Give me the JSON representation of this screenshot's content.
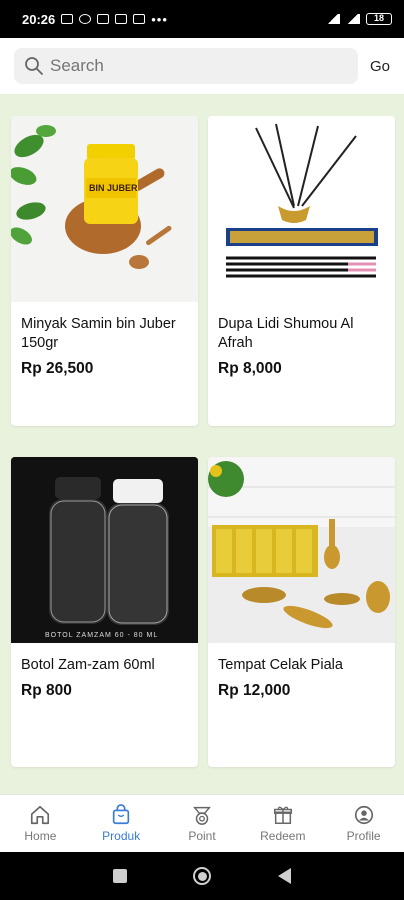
{
  "status": {
    "time": "20:26",
    "battery": "18"
  },
  "search": {
    "placeholder": "Search",
    "go_label": "Go"
  },
  "products": [
    {
      "name": "Minyak Samin bin Juber 150gr",
      "price": "Rp 26,500",
      "image_text": "BIN JUBER"
    },
    {
      "name": "Dupa Lidi Shumou Al Afrah",
      "price": "Rp 8,000"
    },
    {
      "name": "Botol Zam-zam 60ml",
      "price": "Rp 800",
      "image_text": "BOTOL ZAMZAM 60 - 80 ML"
    },
    {
      "name": "Tempat Celak Piala",
      "price": "Rp 12,000"
    }
  ],
  "nav": {
    "items": [
      {
        "label": "Home",
        "icon": "home-icon"
      },
      {
        "label": "Produk",
        "icon": "bag-icon",
        "active": true
      },
      {
        "label": "Point",
        "icon": "point-icon"
      },
      {
        "label": "Redeem",
        "icon": "gift-icon"
      },
      {
        "label": "Profile",
        "icon": "profile-icon"
      }
    ]
  },
  "colors": {
    "accent": "#3a7bd5",
    "background": "#e8f2dd"
  }
}
